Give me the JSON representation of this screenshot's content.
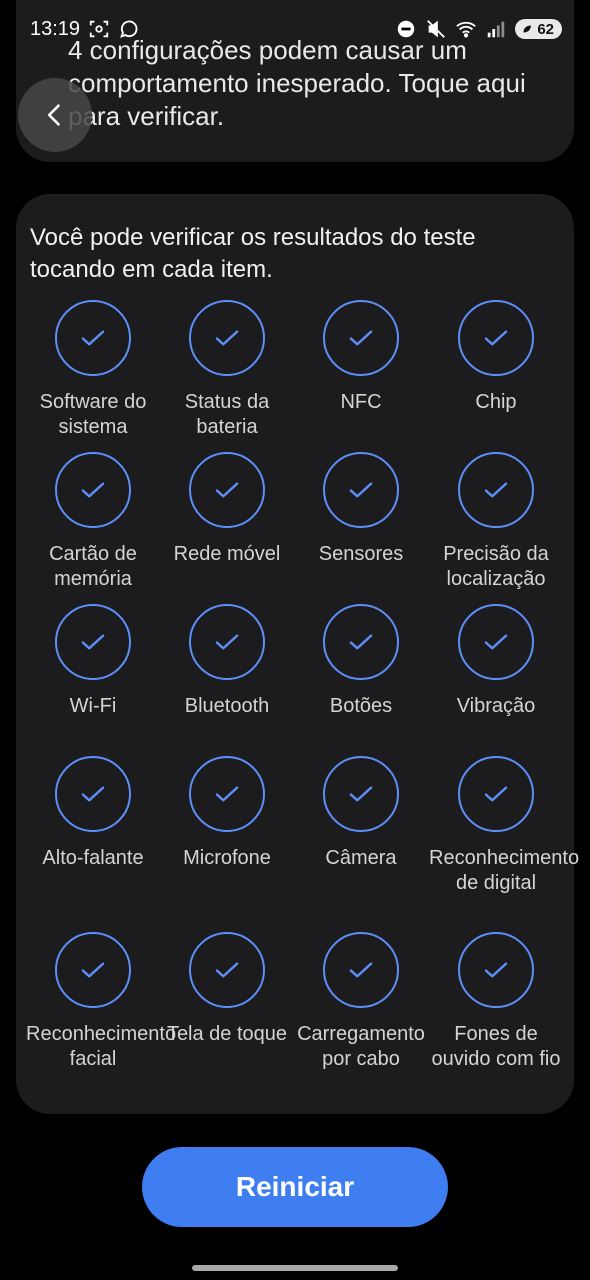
{
  "status_bar": {
    "time": "13:19",
    "battery_level": "62",
    "left_icons": [
      "screenshot-icon",
      "whatsapp-icon"
    ],
    "right_icons": [
      "do-not-disturb-icon",
      "mute-icon",
      "wifi-icon",
      "signal-icon",
      "battery-icon"
    ]
  },
  "warning": {
    "text": "4 configurações podem causar um comportamento inesperado. Toque aqui para verificar."
  },
  "results": {
    "intro": "Você pode verificar os resultados do teste tocando em cada item.",
    "items": [
      {
        "label": "Software do sistema"
      },
      {
        "label": "Status da bateria"
      },
      {
        "label": "NFC"
      },
      {
        "label": "Chip"
      },
      {
        "label": "Cartão de memória"
      },
      {
        "label": "Rede móvel"
      },
      {
        "label": "Sensores"
      },
      {
        "label": "Precisão da localização"
      },
      {
        "label": "Wi-Fi"
      },
      {
        "label": "Bluetooth"
      },
      {
        "label": "Botões"
      },
      {
        "label": "Vibração"
      },
      {
        "label": "Alto-falante"
      },
      {
        "label": "Microfone"
      },
      {
        "label": "Câmera"
      },
      {
        "label": "Reconhecimento de digital"
      },
      {
        "label": "Reconhecimento facial"
      },
      {
        "label": "Tela de toque"
      },
      {
        "label": "Carregamento por cabo"
      },
      {
        "label": "Fones de ouvido com fio"
      }
    ]
  },
  "actions": {
    "restart_label": "Reiniciar"
  },
  "colors": {
    "accent": "#3e7ef0",
    "check": "#5d8ff7",
    "card": "#1c1c1f",
    "background": "#000000"
  }
}
